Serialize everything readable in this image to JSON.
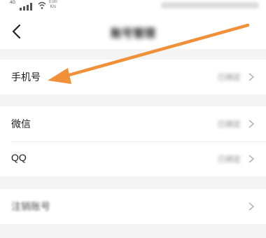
{
  "status_bar": {
    "network": "4G",
    "speed_value": "0.00",
    "speed_unit": "K/s"
  },
  "header": {
    "title": "账号管理"
  },
  "rows": {
    "phone": {
      "label": "手机号",
      "value": "已绑定"
    },
    "wechat": {
      "label": "微信",
      "value": "已绑定"
    },
    "qq": {
      "label": "QQ",
      "value": "已绑定"
    },
    "deactivate": {
      "label": "注销账号"
    }
  },
  "colors": {
    "background": "#f4f4f4",
    "card": "#ffffff",
    "annotation_arrow": "#f0913a"
  }
}
